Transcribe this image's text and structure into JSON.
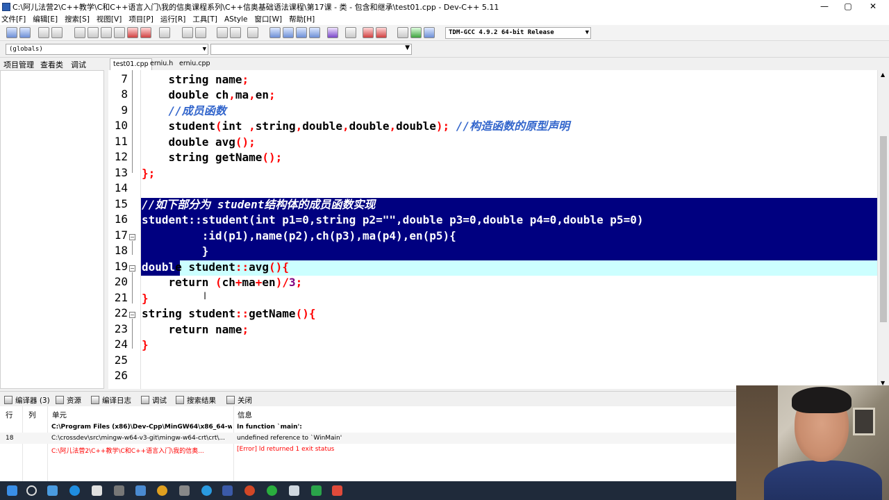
{
  "window": {
    "title": "C:\\阿儿法营2\\C++教学\\C和C++语言入门\\我的信奥课程系列\\C++信奥基础语法课程\\第17课 - 类 - 包含和继承\\test01.cpp - Dev-C++ 5.11",
    "minimize": "—",
    "maximize": "▢",
    "close": "✕"
  },
  "menu": [
    "文件[F]",
    "编辑[E]",
    "搜索[S]",
    "视图[V]",
    "项目[P]",
    "运行[R]",
    "工具[T]",
    "AStyle",
    "窗口[W]",
    "帮助[H]"
  ],
  "toolbar": {
    "compiler": "TDM-GCC 4.9.2 64-bit Release"
  },
  "scope": {
    "globals": "(globals)"
  },
  "left_tabs": [
    "项目管理",
    "查看类",
    "调试"
  ],
  "editor_tabs": [
    "test01.cpp",
    "erniu.h",
    "erniu.cpp"
  ],
  "code": {
    "lines": [
      {
        "n": "7",
        "text": "    string name;"
      },
      {
        "n": "8",
        "text": "    double ch,ma,en;"
      },
      {
        "n": "9",
        "text": "    //成员函数"
      },
      {
        "n": "10",
        "text": "    student(int ,string,double,double,double); //构造函数的原型声明"
      },
      {
        "n": "11",
        "text": "    double avg();"
      },
      {
        "n": "12",
        "text": "    string getName();"
      },
      {
        "n": "13",
        "text": "};"
      },
      {
        "n": "14",
        "text": ""
      },
      {
        "n": "15",
        "text": "//如下部分为 student结构体的成员函数实现"
      },
      {
        "n": "16",
        "text": "student::student(int p1=0,string p2=\"\",double p3=0,double p4=0,double p5=0)"
      },
      {
        "n": "17",
        "text": "         :id(p1),name(p2),ch(p3),ma(p4),en(p5){"
      },
      {
        "n": "18",
        "text": "         }"
      },
      {
        "n": "19",
        "text": "double student::avg(){"
      },
      {
        "n": "20",
        "text": "    return (ch+ma+en)/3;"
      },
      {
        "n": "21",
        "text": "}"
      },
      {
        "n": "22",
        "text": "string student::getName(){"
      },
      {
        "n": "23",
        "text": "    return name;"
      },
      {
        "n": "24",
        "text": "}"
      },
      {
        "n": "25",
        "text": ""
      },
      {
        "n": "26",
        "text": ""
      }
    ]
  },
  "bottom_tabs": [
    "编译器 (3)",
    "资源",
    "编译日志",
    "调试",
    "搜索结果",
    "关闭"
  ],
  "messages": {
    "headers": [
      "行",
      "列",
      "单元",
      "信息"
    ],
    "rows": [
      {
        "line": "",
        "col": "",
        "unit": "C:\\Program Files (x86)\\Dev-Cpp\\MinGW64\\x86_64-w...",
        "info": "In function `main':"
      },
      {
        "line": "18",
        "col": "",
        "unit": "C:\\crossdev\\src\\mingw-w64-v3-git\\mingw-w64-crt\\crt\\...",
        "info": "undefined reference to `WinMain'"
      },
      {
        "line": "",
        "col": "",
        "unit": "C:\\阿儿法营2\\C++教学\\C和C++语言入门\\我的信奥...",
        "info": "[Error] ld returned 1 exit status"
      }
    ]
  },
  "colors": {
    "selection": "#000080",
    "current_line": "#ccffff",
    "symbol": "#ff0000",
    "comment": "#3366cc",
    "error_text": "#ff0000"
  }
}
